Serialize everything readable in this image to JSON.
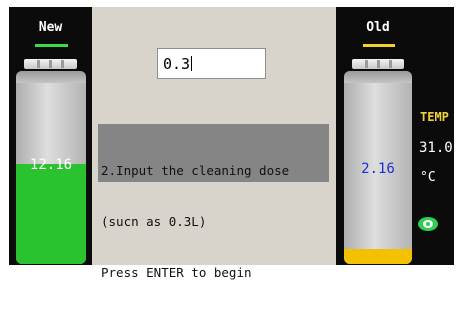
{
  "left_panel": {
    "title": "New",
    "indicator_color": "#3adb4a",
    "value": "12.16",
    "fill_color": "#2bc22f",
    "value_color": "#ffffff",
    "fill_level": 0.52
  },
  "right_panel": {
    "title": "Old",
    "indicator_color": "#f0d12f",
    "value": "2.16",
    "fill_color": "#f2c200",
    "value_color": "#1d2fd6",
    "fill_level": 0.08
  },
  "center": {
    "dose_input_value": "0.3",
    "message_lines": [
      "2.Input the cleaning dose",
      "(sucn as 0.3L)",
      "Press ENTER to begin"
    ]
  },
  "temperature": {
    "label": "TEMP",
    "value": "31.0",
    "unit": "°C"
  },
  "icons": {
    "status": "eye-icon"
  }
}
